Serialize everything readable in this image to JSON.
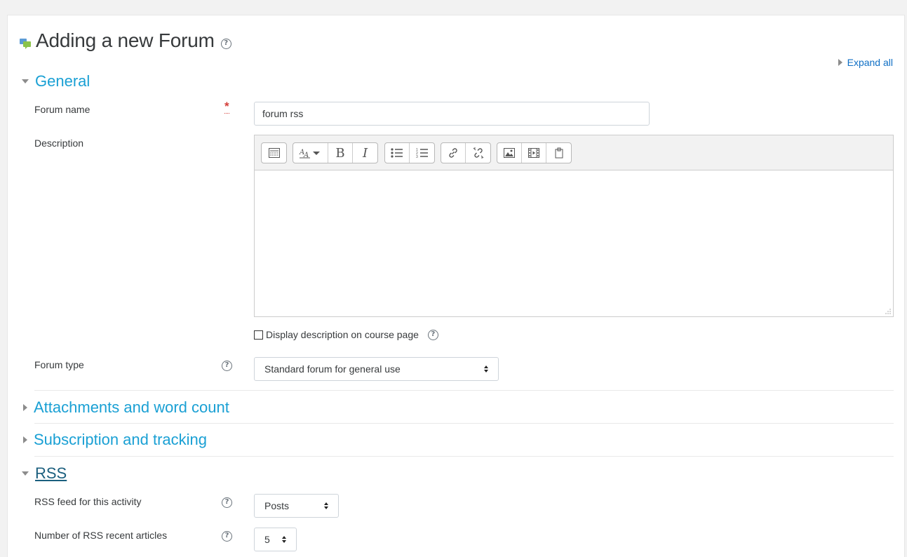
{
  "page": {
    "title": "Adding a new Forum"
  },
  "expand_all": "Expand all",
  "sections": {
    "general": "General",
    "attachments": "Attachments and word count",
    "subscription": "Subscription and tracking",
    "rss": "RSS"
  },
  "form": {
    "forum_name_label": "Forum name",
    "forum_name_value": "forum rss",
    "required_marker": "*",
    "description_label": "Description",
    "display_description_label": "Display description on course page",
    "forum_type_label": "Forum type",
    "forum_type_value": "Standard forum for general use",
    "rss_feed_label": "RSS feed for this activity",
    "rss_feed_value": "Posts",
    "rss_articles_label": "Number of RSS recent articles",
    "rss_articles_value": "5"
  },
  "toolbar": {
    "groups": [
      [
        "toolbar-toggle-icon"
      ],
      [
        "font-style-icon",
        "bold-icon",
        "italic-icon"
      ],
      [
        "unordered-list-icon",
        "ordered-list-icon"
      ],
      [
        "link-icon",
        "unlink-icon"
      ],
      [
        "image-icon",
        "media-icon",
        "file-icon"
      ]
    ],
    "bold_glyph": "B",
    "italic_glyph": "I"
  },
  "help_glyph": "?",
  "colors": {
    "link": "#0f6fc5",
    "section": "#1aa0d4",
    "required": "#d43f3a"
  }
}
